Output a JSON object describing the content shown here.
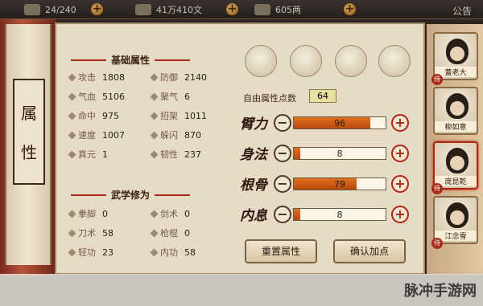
{
  "topbar": {
    "res1": "24/240",
    "res2": "41万410文",
    "res3": "605两",
    "notice": "公告"
  },
  "scroll": {
    "char1": "属",
    "char2": "性"
  },
  "basic": {
    "title": "基础属性",
    "stats": [
      {
        "label": "攻击",
        "value": "1808"
      },
      {
        "label": "防御",
        "value": "2140"
      },
      {
        "label": "气血",
        "value": "5106"
      },
      {
        "label": "聚气",
        "value": "6"
      },
      {
        "label": "命中",
        "value": "975"
      },
      {
        "label": "招架",
        "value": "1011"
      },
      {
        "label": "速度",
        "value": "1007"
      },
      {
        "label": "躲闪",
        "value": "870"
      },
      {
        "label": "真元",
        "value": "1"
      },
      {
        "label": "韧性",
        "value": "237"
      }
    ]
  },
  "martial": {
    "title": "武学修为",
    "stats": [
      {
        "label": "拳脚",
        "value": "0"
      },
      {
        "label": "剑术",
        "value": "0"
      },
      {
        "label": "刀术",
        "value": "58"
      },
      {
        "label": "枪棍",
        "value": "0"
      },
      {
        "label": "轻功",
        "value": "23"
      },
      {
        "label": "内功",
        "value": "58"
      }
    ]
  },
  "free_points": {
    "label": "自由属性点数",
    "value": "64"
  },
  "attributes": [
    {
      "name": "臂力",
      "value": "96",
      "fill": 0.83
    },
    {
      "name": "身法",
      "value": "8",
      "fill": 0.07
    },
    {
      "name": "根骨",
      "value": "79",
      "fill": 0.68
    },
    {
      "name": "内息",
      "value": "8",
      "fill": 0.07
    }
  ],
  "buttons": {
    "reset": "重置属性",
    "confirm": "确认加点"
  },
  "roster": [
    {
      "name": "蓋老大",
      "selected": false
    },
    {
      "name": "柳如意",
      "selected": false
    },
    {
      "name": "庞昆乾",
      "selected": true
    },
    {
      "name": "江念雪",
      "selected": false
    }
  ],
  "watermark": "脉冲手游网"
}
